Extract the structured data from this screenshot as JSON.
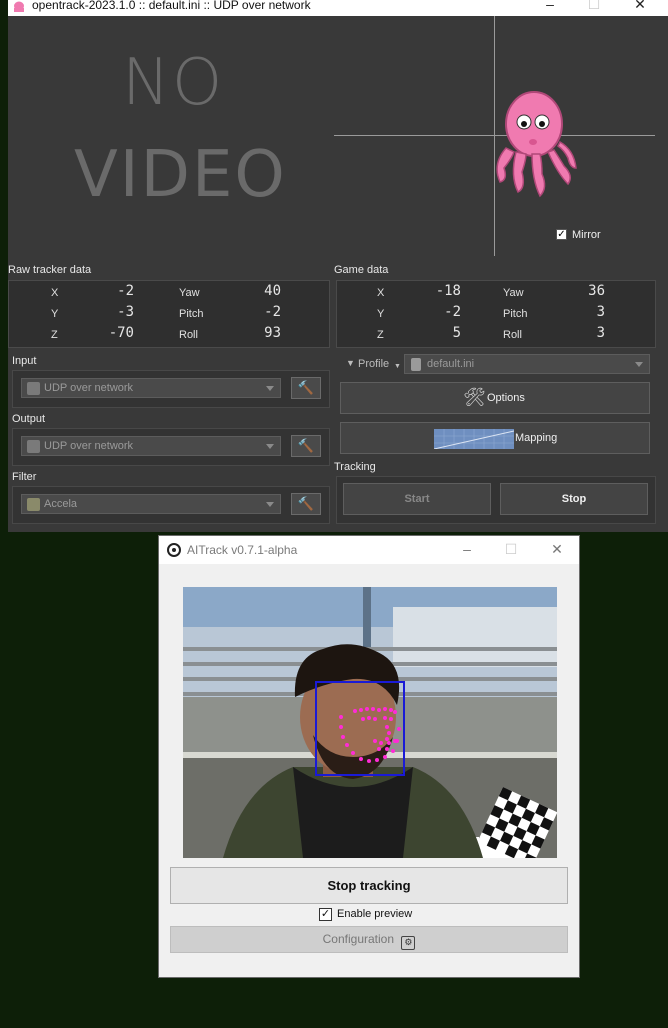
{
  "opentrack": {
    "title": "opentrack-2023.1.0 :: default.ini :: UDP over network",
    "video_placeholder": {
      "line1": "NO",
      "line2": "VIDEO"
    },
    "mirror": {
      "label": "Mirror",
      "checked": true
    },
    "raw_tracker_data": {
      "heading": "Raw tracker data",
      "rows": [
        {
          "axis": "X",
          "axis_value": "-2",
          "rot": "Yaw",
          "rot_value": "40"
        },
        {
          "axis": "Y",
          "axis_value": "-3",
          "rot": "Pitch",
          "rot_value": "-2"
        },
        {
          "axis": "Z",
          "axis_value": "-70",
          "rot": "Roll",
          "rot_value": "93"
        }
      ]
    },
    "game_data": {
      "heading": "Game data",
      "rows": [
        {
          "axis": "X",
          "axis_value": "-18",
          "rot": "Yaw",
          "rot_value": "36"
        },
        {
          "axis": "Y",
          "axis_value": "-2",
          "rot": "Pitch",
          "rot_value": "3"
        },
        {
          "axis": "Z",
          "axis_value": "5",
          "rot": "Roll",
          "rot_value": "3"
        }
      ]
    },
    "input": {
      "heading": "Input",
      "value": "UDP over network"
    },
    "output": {
      "heading": "Output",
      "value": "UDP over network"
    },
    "filter": {
      "heading": "Filter",
      "value": "Accela"
    },
    "profile": {
      "label": "Profile",
      "value": "default.ini"
    },
    "options_label": "Options",
    "mapping_label": "Mapping",
    "tracking": {
      "heading": "Tracking",
      "start_label": "Start",
      "stop_label": "Stop"
    }
  },
  "aitrack": {
    "title": "AITrack v0.7.1-alpha",
    "stop_tracking_label": "Stop tracking",
    "enable_preview": {
      "label": "Enable preview",
      "checked": true
    },
    "configuration_label": "Configuration"
  },
  "colors": {
    "opentrack_bg": "#393939",
    "desktop_bg": "#0d1f08",
    "face_box": "#1a1ad6",
    "landmarks": "#ff2bd6"
  }
}
